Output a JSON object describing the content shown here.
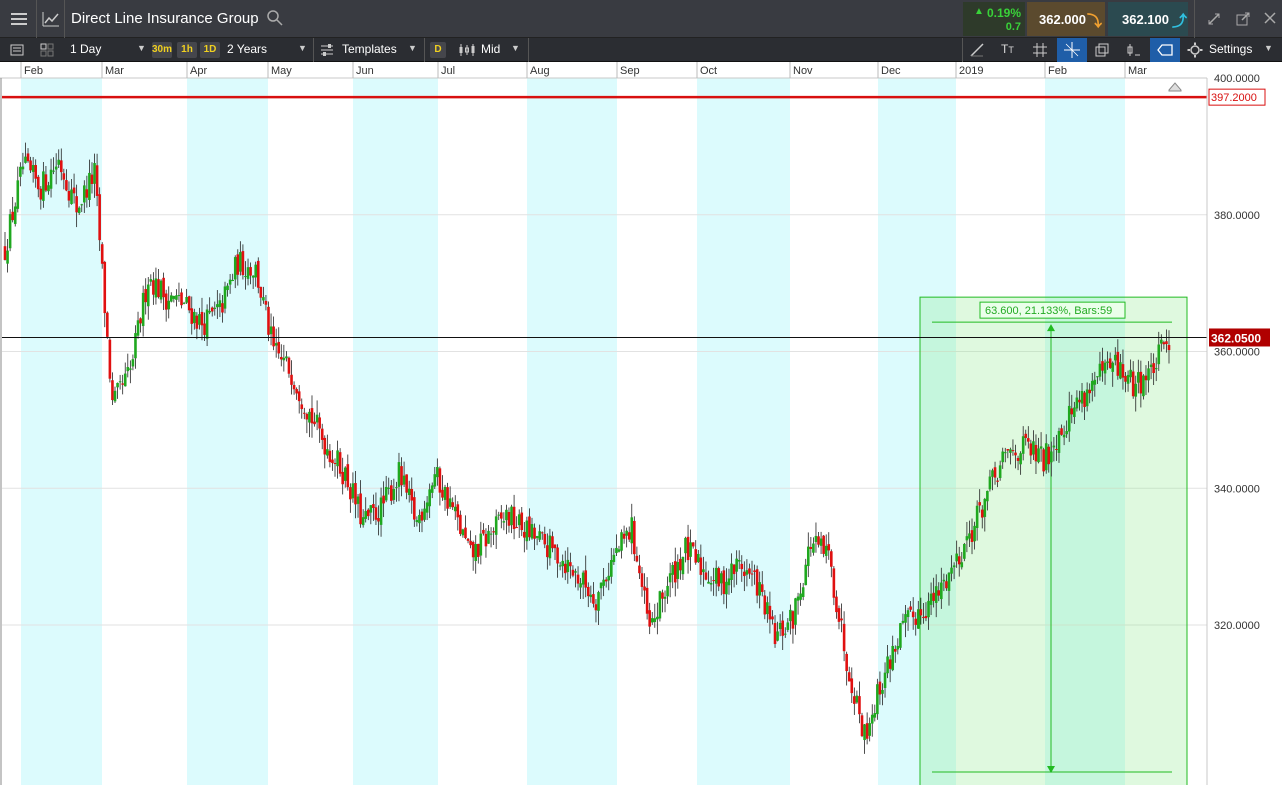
{
  "header": {
    "title": "Direct Line Insurance Group",
    "change_pct": "0.19%",
    "change_abs": "0.7",
    "sell_price": "362.000",
    "buy_price": "362.100"
  },
  "toolbar": {
    "interval": "1 Day",
    "timeframes": [
      "30m",
      "1h",
      "1D"
    ],
    "period": "2 Years",
    "templates_label": "Templates",
    "d_label": "D",
    "price_type": "Mid",
    "settings_label": "Settings"
  },
  "chart": {
    "months": [
      "Feb",
      "Mar",
      "Apr",
      "May",
      "Jun",
      "Jul",
      "Aug",
      "Sep",
      "Oct",
      "Nov",
      "Dec",
      "2019",
      "Feb",
      "Mar"
    ],
    "price_ticks": [
      "400.0000",
      "380.0000",
      "360.0000",
      "340.0000",
      "320.0000"
    ],
    "resistance_label": "397.2000",
    "current_label": "362.0500",
    "measure_label": "63.600, 21.133%, Bars:59",
    "colors": {
      "up": "#1fa81f",
      "down": "#e01010",
      "resistance": "#d81010",
      "current_bg": "#b00000",
      "measure": "#22bb22",
      "shade": "#dcfbfd"
    }
  },
  "chart_data": {
    "type": "candlestick",
    "title": "Direct Line Insurance Group",
    "ylim": [
      300,
      410
    ],
    "horizontal_lines": [
      397.2,
      362.05
    ],
    "measure": {
      "start": 298.5,
      "end": 362.1,
      "change": 63.6,
      "percent": 21.133,
      "bars": 59
    },
    "x": [
      "Feb",
      "Mar",
      "Apr",
      "May",
      "Jun",
      "Jul",
      "Aug",
      "Sep",
      "Oct",
      "Nov",
      "Dec",
      "2019",
      "Feb",
      "Mar"
    ],
    "close": [
      375,
      387,
      384,
      388,
      381,
      386,
      352,
      357,
      371,
      368,
      367,
      364,
      366,
      373,
      372,
      360,
      357,
      351,
      346,
      342,
      335,
      337,
      342,
      335,
      342,
      337,
      330,
      333,
      336,
      334,
      332,
      330,
      327,
      324,
      330,
      334,
      319,
      326,
      331,
      328,
      326,
      329,
      326,
      318,
      321,
      332,
      330,
      315,
      304,
      312,
      319,
      322,
      324,
      329,
      334,
      340,
      345,
      346,
      344,
      349,
      353,
      356,
      358,
      355,
      357,
      362
    ]
  }
}
